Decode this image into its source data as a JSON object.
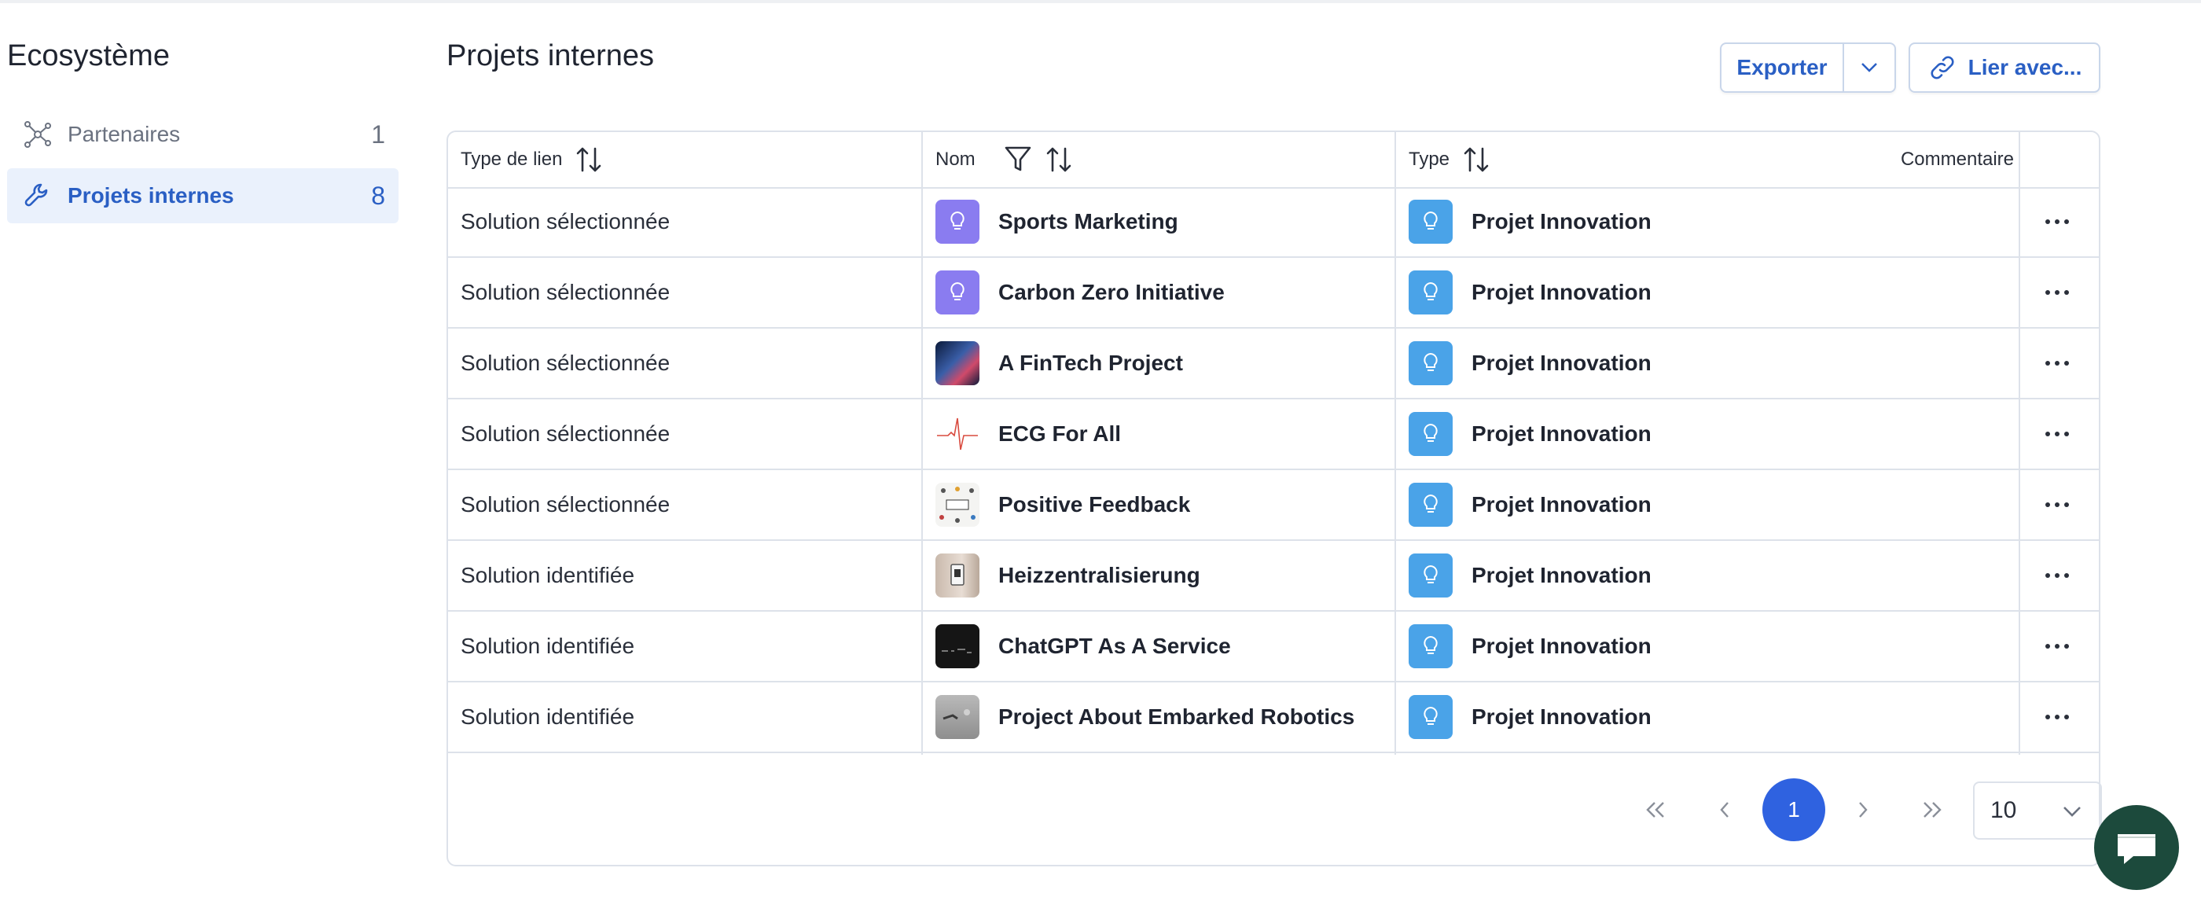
{
  "sidebar": {
    "title": "Ecosystème",
    "items": [
      {
        "label": "Partenaires",
        "count": "1",
        "icon": "network-icon"
      },
      {
        "label": "Projets internes",
        "count": "8",
        "icon": "wrench-icon"
      }
    ]
  },
  "header": {
    "title": "Projets internes",
    "export_label": "Exporter",
    "link_label": "Lier avec..."
  },
  "table": {
    "columns": {
      "link_type": "Type de lien",
      "name": "Nom",
      "type": "Type",
      "comment": "Commentaire"
    },
    "rows": [
      {
        "link_type": "Solution sélectionnée",
        "name": "Sports Marketing",
        "type": "Projet Innovation",
        "thumb": "bulb-purple"
      },
      {
        "link_type": "Solution sélectionnée",
        "name": "Carbon Zero Initiative",
        "type": "Projet Innovation",
        "thumb": "bulb-purple"
      },
      {
        "link_type": "Solution sélectionnée",
        "name": "A FinTech Project",
        "type": "Projet Innovation",
        "thumb": "image-city"
      },
      {
        "link_type": "Solution sélectionnée",
        "name": "ECG For All",
        "type": "Projet Innovation",
        "thumb": "image-ecg"
      },
      {
        "link_type": "Solution sélectionnée",
        "name": "Positive Feedback",
        "type": "Projet Innovation",
        "thumb": "image-feedback"
      },
      {
        "link_type": "Solution identifiée",
        "name": "Heizzentralisierung",
        "type": "Projet Innovation",
        "thumb": "image-thermostat"
      },
      {
        "link_type": "Solution identifiée",
        "name": "ChatGPT As A Service",
        "type": "Projet Innovation",
        "thumb": "image-dark"
      },
      {
        "link_type": "Solution identifiée",
        "name": "Project About Embarked Robotics",
        "type": "Projet Innovation",
        "thumb": "image-robot"
      }
    ]
  },
  "pagination": {
    "current_page": "1",
    "page_size": "10"
  },
  "colors": {
    "accent": "#2a5fc4",
    "active_bg": "#eaf1fc",
    "type_icon": "#4aa3e8",
    "bulb_purple": "#8a7cf0",
    "page_current": "#2f62e0",
    "chat": "#1c4a3c"
  }
}
